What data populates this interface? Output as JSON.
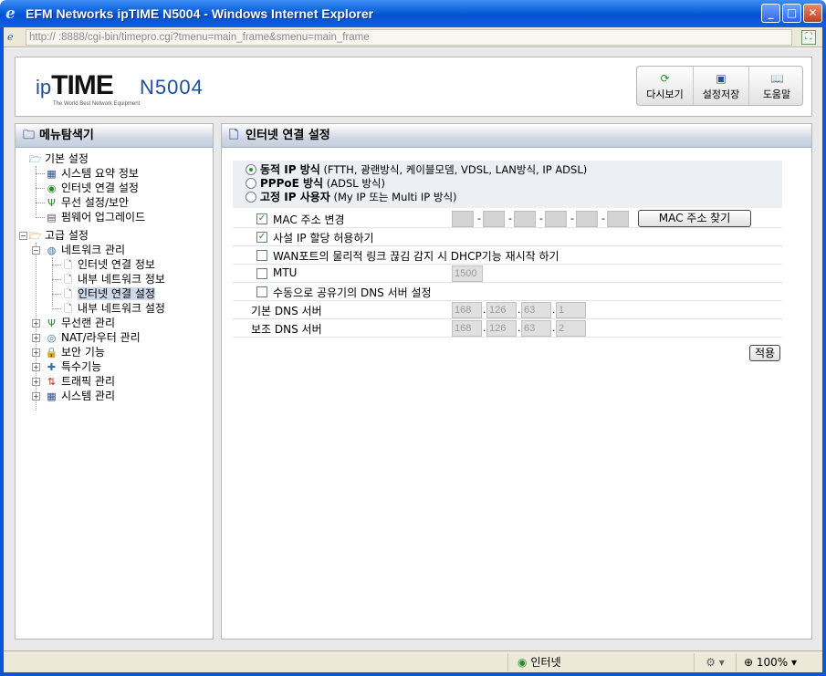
{
  "window": {
    "title": "EFM Networks ipTIME N5004 - Windows Internet Explorer",
    "address": "http://                          :8888/cgi-bin/timepro.cgi?tmenu=main_frame&smenu=main_frame"
  },
  "header": {
    "logo_ip": "ip",
    "logo_time": "TIME",
    "logo_tagline": "The World Best Network Equipment",
    "model": "N5004",
    "toolbar": [
      {
        "label": "다시보기",
        "icon": "refresh-icon"
      },
      {
        "label": "설정저장",
        "icon": "save-disk-icon"
      },
      {
        "label": "도움말",
        "icon": "help-book-icon"
      }
    ]
  },
  "sidebar": {
    "title": "메뉴탐색기",
    "basic": {
      "label": "기본 설정",
      "items": [
        "시스템 요약 정보",
        "인터넷 연결 설정",
        "무선 설정/보안",
        "펌웨어 업그레이드"
      ]
    },
    "advanced": {
      "label": "고급 설정",
      "network": {
        "label": "네트워크 관리",
        "items": [
          "인터넷 연결 정보",
          "내부 네트워크 정보",
          "인터넷 연결 설정",
          "내부 네트워크 설정"
        ]
      },
      "others": [
        "무선랜 관리",
        "NAT/라우터 관리",
        "보안 기능",
        "특수기능",
        "트래픽 관리",
        "시스템 관리"
      ]
    }
  },
  "main": {
    "title": "인터넷 연결 설정",
    "connection_types": [
      {
        "name": "동적 IP 방식",
        "desc": "(FTTH, 광랜방식, 케이블모뎀, VDSL, LAN방식, IP ADSL)",
        "selected": true
      },
      {
        "name": "PPPoE 방식",
        "desc": "(ADSL 방식)",
        "selected": false
      },
      {
        "name": "고정 IP 사용자",
        "desc": "(My IP 또는 Multi IP 방식)",
        "selected": false
      }
    ],
    "options": {
      "mac_change": {
        "label": "MAC 주소 변경",
        "checked": true
      },
      "mac_find_button": "MAC 주소 찾기",
      "private_ip": {
        "label": "사설 IP 할당 허용하기",
        "checked": true
      },
      "wan_detect": {
        "label": "WAN포트의 물리적 링크 끊김 감지 시 DHCP기능 재시작 하기",
        "checked": false
      },
      "mtu": {
        "label": "MTU",
        "checked": false,
        "value": "1500"
      },
      "manual_dns": {
        "label": "수동으로 공유기의 DNS 서버 설정",
        "checked": false
      }
    },
    "mac_octets": [
      "",
      "",
      "",
      "",
      "",
      ""
    ],
    "primary_dns": {
      "label": "기본 DNS 서버",
      "octets": [
        "168",
        "126",
        "63",
        "1"
      ]
    },
    "secondary_dns": {
      "label": "보조 DNS 서버",
      "octets": [
        "168",
        "126",
        "63",
        "2"
      ]
    },
    "apply_button": "적용"
  },
  "statusbar": {
    "zone": "인터넷",
    "zoom": "100%"
  }
}
